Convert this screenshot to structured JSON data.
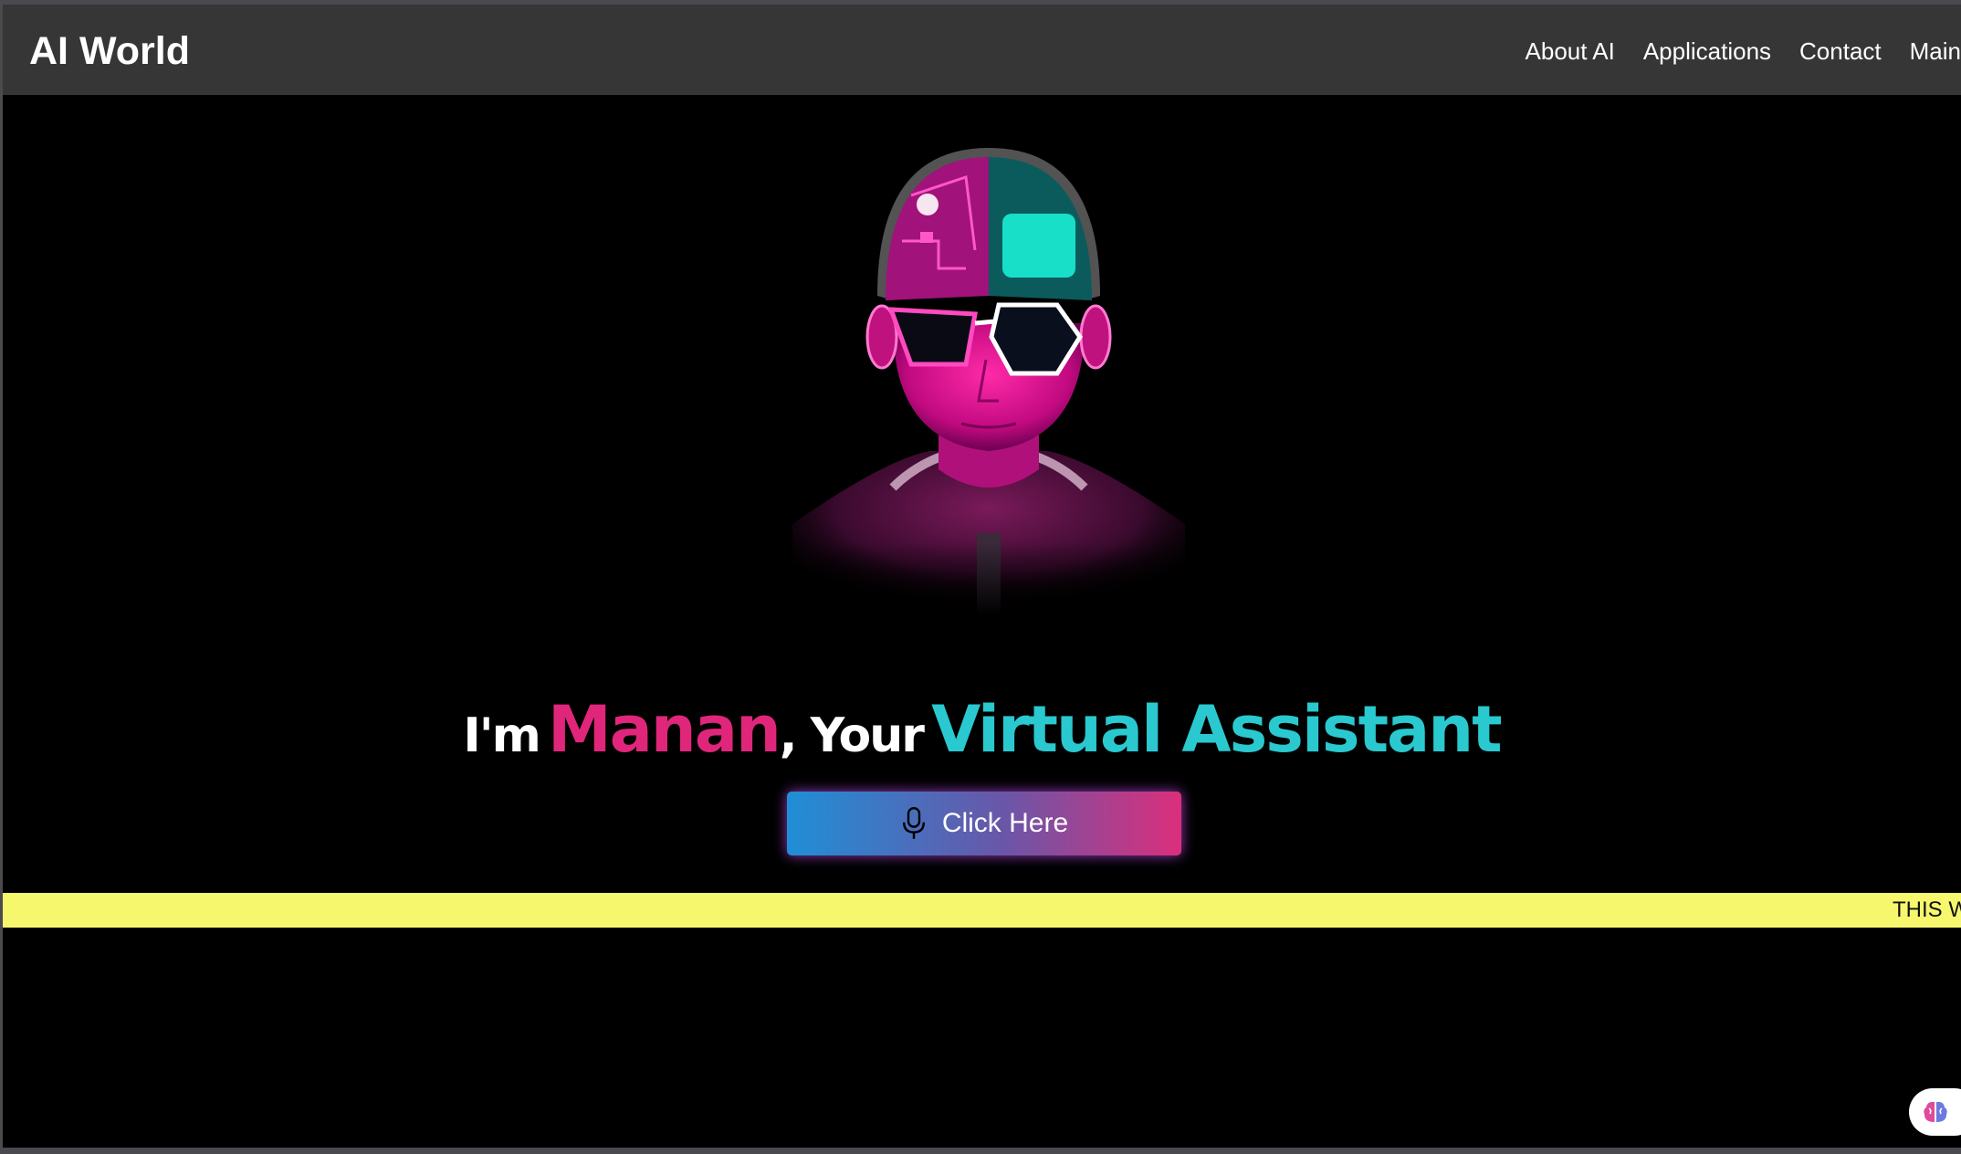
{
  "navbar": {
    "brand": "AI World",
    "links": [
      {
        "label": "About AI"
      },
      {
        "label": "Applications"
      },
      {
        "label": "Contact"
      },
      {
        "label": "Main"
      }
    ]
  },
  "hero": {
    "image_icon": "cyberpunk-android-portrait",
    "headline": {
      "prefix": "I'm",
      "name": "Manan",
      "middle": ", Your",
      "role": "Virtual Assistant"
    },
    "button": {
      "label": "Click Here",
      "icon": "microphone-icon"
    }
  },
  "ticker": {
    "text": "THIS W"
  },
  "chat_widget": {
    "icon": "brain-icon"
  },
  "colors": {
    "navbar_bg": "#363636",
    "page_bg": "#000000",
    "name_accent": "#e0267a",
    "role_accent": "#29c9cf",
    "ticker_bg": "#f7f76d",
    "button_gradient_start": "#1f8fd6",
    "button_gradient_end": "#db2f7b"
  }
}
